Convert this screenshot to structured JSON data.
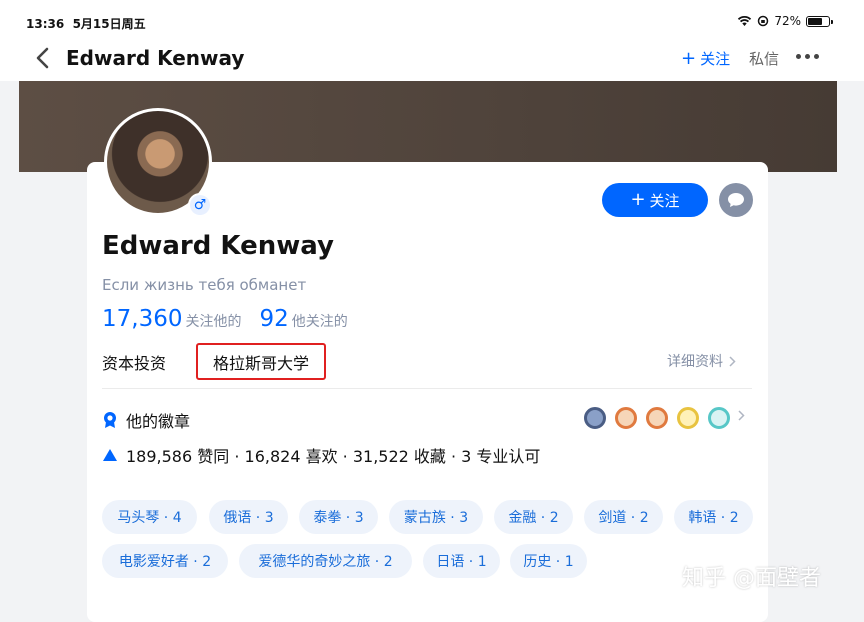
{
  "status_bar": {
    "time": "13:36",
    "date": "5月15日周五",
    "battery": "72%",
    "battery_level": 0.72
  },
  "nav": {
    "title": "Edward Kenway",
    "follow_label": "关注",
    "message_label": "私信"
  },
  "profile": {
    "name": "Edward Kenway",
    "headline": "Если жизнь тебя обманет",
    "followers_count": "17,360",
    "followers_label": "关注他的",
    "following_count": "92",
    "following_label": "他关注的",
    "industry": "资本投资",
    "education": "格拉斯哥大学",
    "details_label": "详细资料",
    "follow_button_label": "关注"
  },
  "badges": {
    "label": "他的徽章"
  },
  "achievements": {
    "text": "189,586 赞同 · 16,824 喜欢 · 31,522 收藏 · 3 专业认可"
  },
  "tags": [
    "马头琴 · 4",
    "俄语 · 3",
    "泰拳 · 3",
    "蒙古族 · 3",
    "金融 · 2",
    "剑道 · 2",
    "韩语 · 2",
    "电影爱好者 · 2",
    "爱德华的奇妙之旅 · 2",
    "日语 · 1",
    "历史 · 1"
  ],
  "watermark": "知乎 @面壁者",
  "colors": {
    "accent": "#0066ff",
    "muted": "#8590a6",
    "highlight_box": "#e02020",
    "tag_bg": "#eef3fb"
  }
}
